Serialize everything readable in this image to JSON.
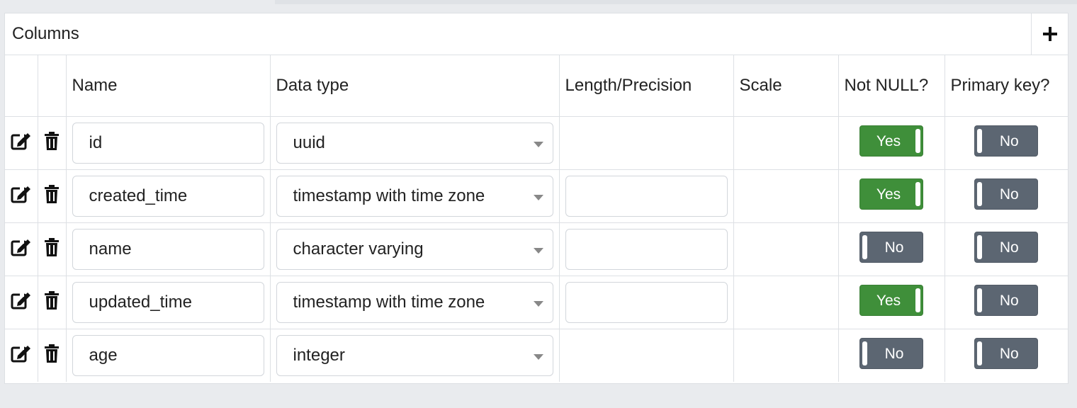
{
  "panel": {
    "title": "Columns",
    "add_label": "+"
  },
  "headers": {
    "name": "Name",
    "data_type": "Data type",
    "length": "Length/Precision",
    "scale": "Scale",
    "not_null": "Not NULL?",
    "primary_key": "Primary key?"
  },
  "icons": {
    "edit": "edit-icon",
    "delete": "trash-icon",
    "add": "plus-icon"
  },
  "colors": {
    "toggle_on": "#3f8f3a",
    "toggle_off": "#5c6672"
  },
  "rows": [
    {
      "name": "id",
      "data_type": "uuid",
      "length": "",
      "length_editable": false,
      "scale": "",
      "not_null": "Yes",
      "not_null_on": true,
      "primary_key": "No",
      "primary_key_on": false
    },
    {
      "name": "created_time",
      "data_type": "timestamp with time zone",
      "length": "",
      "length_editable": true,
      "scale": "",
      "not_null": "Yes",
      "not_null_on": true,
      "primary_key": "No",
      "primary_key_on": false
    },
    {
      "name": "name",
      "data_type": "character varying",
      "length": "",
      "length_editable": true,
      "scale": "",
      "not_null": "No",
      "not_null_on": false,
      "primary_key": "No",
      "primary_key_on": false
    },
    {
      "name": "updated_time",
      "data_type": "timestamp with time zone",
      "length": "",
      "length_editable": true,
      "scale": "",
      "not_null": "Yes",
      "not_null_on": true,
      "primary_key": "No",
      "primary_key_on": false
    },
    {
      "name": "age",
      "data_type": "integer",
      "length": "",
      "length_editable": false,
      "scale": "",
      "not_null": "No",
      "not_null_on": false,
      "primary_key": "No",
      "primary_key_on": false
    }
  ]
}
